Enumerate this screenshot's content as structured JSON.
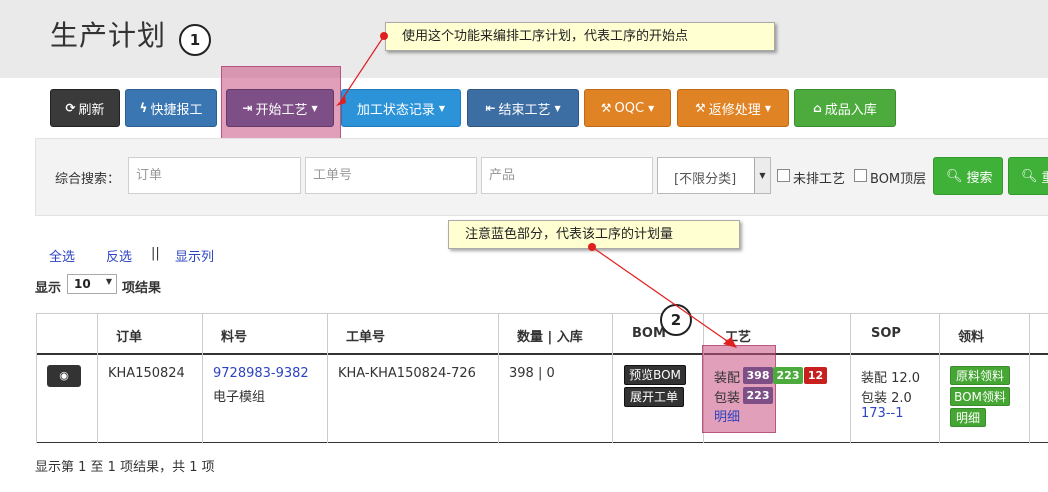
{
  "header": {
    "title": "生产计划"
  },
  "annotations": {
    "step1": "1",
    "step2": "2",
    "callout1": "使用这个功能来编排工序计划，代表工序的开始点",
    "callout2": "注意蓝色部分，代表该工序的计划量"
  },
  "toolbar": {
    "refresh": "刷新",
    "quick_report": "快捷报工",
    "start_process": "开始工艺",
    "process_status_log": "加工状态记录",
    "end_process": "结束工艺",
    "oqc": "OQC",
    "rework": "返修处理",
    "finished_storage": "成品入库"
  },
  "search": {
    "label": "综合搜索：",
    "order_placeholder": "订单",
    "workorder_placeholder": "工单号",
    "product_placeholder": "产品",
    "category_selected": "[不限分类]",
    "unscheduled_label": "未排工艺",
    "bom_top_label": "BOM顶层",
    "search_button": "搜索",
    "reset_button": "重"
  },
  "list_controls": {
    "select_all": "全选",
    "invert": "反选",
    "separator": "||",
    "show_columns": "显示列",
    "show_prefix": "显示",
    "page_length": "10",
    "show_suffix": "项结果"
  },
  "table": {
    "headers": [
      "订单",
      "料号",
      "工单号",
      "数量 | 入库",
      "BOM",
      "工艺",
      "SOP",
      "领料"
    ],
    "row": {
      "order": "KHA150824",
      "part_no": "9728983-9382",
      "part_desc": "电子模组",
      "workorder": "KHA-KHA150824-726",
      "qty": "398 | 0",
      "bom_preview": "预览BOM",
      "bom_expand": "展开工单",
      "proc1_name": "装配",
      "proc1_plan": "398",
      "proc1_done": "223",
      "proc1_ng": "12",
      "proc2_name": "包装",
      "proc2_plan": "223",
      "proc_detail": "明细",
      "sop1": "装配 12.0",
      "sop2": "包装 2.0",
      "sop_link": "173--1",
      "mat_raw": "原料领料",
      "mat_bom": "BOM领料",
      "mat_detail": "明细"
    }
  },
  "footer": {
    "info": "显示第 1 至 1 项结果，共 1 项"
  },
  "colors": {
    "accent_purple": "#7e4f86",
    "success_green": "#4cab3c",
    "danger_red": "#c8201f",
    "highlight": "#c85082"
  },
  "icons": {
    "refresh": "refresh-icon",
    "quick_report": "bolt-icon",
    "start": "sign-out-icon",
    "end": "sign-in-icon",
    "oqc": "gavel-icon",
    "rework": "gavel-icon",
    "storage": "bank-icon",
    "search": "search-icon",
    "view": "eye-icon"
  }
}
